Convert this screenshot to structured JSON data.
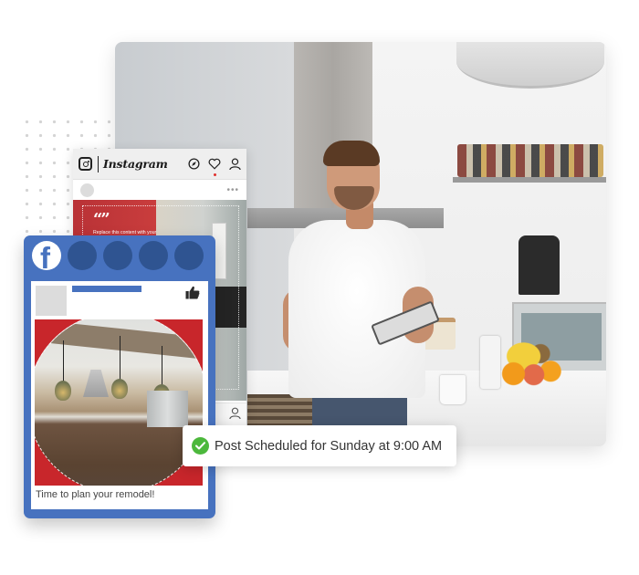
{
  "colors": {
    "facebook_blue": "#4772bf",
    "facebook_dark_circle": "#2f5491",
    "success_green": "#4cb83c",
    "instagram_notification_dot": "#e0312e",
    "brand_red": "#c8262b"
  },
  "hero_photo": {
    "description": "Man in white t-shirt holding a tablet in a bright kitchen"
  },
  "instagram": {
    "wordmark": "Instagram",
    "icons": [
      "instagram-logo-icon",
      "compass-icon",
      "heart-icon",
      "user-icon"
    ],
    "post": {
      "more_label": "•••",
      "quote_mark": "“”",
      "quote_text": "Replace this content with your own content. Content"
    },
    "footer_icons": [
      "user-icon"
    ]
  },
  "facebook": {
    "logo_letter": "f",
    "story_circles": 4,
    "post": {
      "reaction_icon": "thumbs-up-icon",
      "caption": "Time to plan your remodel!"
    }
  },
  "notification": {
    "icon": "check-circle-icon",
    "text": "Post Scheduled for Sunday at 9:00 AM"
  }
}
